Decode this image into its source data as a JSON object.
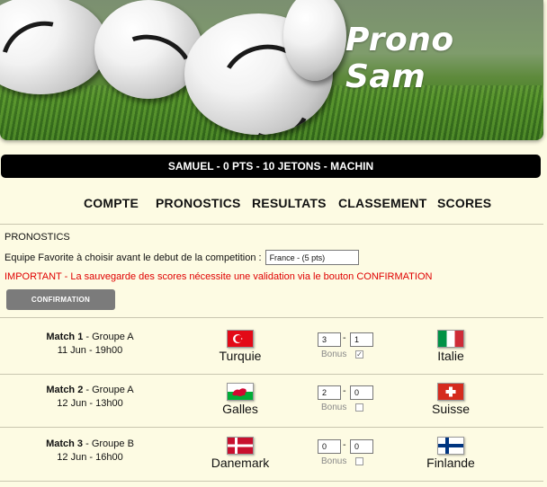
{
  "banner": {
    "brand": "Prono Sam"
  },
  "user_bar": {
    "text": "SAMUEL - 0 PTS - 10 JETONS - MACHIN"
  },
  "nav": {
    "items": [
      "COMPTE",
      "PRONOSTICS",
      "RESULTATS",
      "CLASSEMENT",
      "SCORES"
    ]
  },
  "section": {
    "title": "PRONOSTICS",
    "favorite_label": "Equipe Favorite à choisir avant le debut de la competition :",
    "favorite_value": "France - (5 pts)",
    "important": "IMPORTANT - La sauvegarde des scores nécessite une validation via le bouton CONFIRMATION",
    "confirm_label": "CONFIRMATION"
  },
  "matches": [
    {
      "match": "Match 1",
      "group": " - Groupe A",
      "date": "11 Jun - 19h00",
      "home": "Turquie",
      "away": "Italie",
      "home_score": "3",
      "away_score": "1",
      "bonus_label": "Bonus",
      "bonus_checked": true,
      "home_flag": "turkey-flag",
      "away_flag": "italy-flag"
    },
    {
      "match": "Match 2",
      "group": " - Groupe A",
      "date": "12 Jun - 13h00",
      "home": "Galles",
      "away": "Suisse",
      "home_score": "2",
      "away_score": "0",
      "bonus_label": "Bonus",
      "bonus_checked": false,
      "home_flag": "wales-flag",
      "away_flag": "switzerland-flag"
    },
    {
      "match": "Match 3",
      "group": " - Groupe B",
      "date": "12 Jun - 16h00",
      "home": "Danemark",
      "away": "Finlande",
      "home_score": "0",
      "away_score": "0",
      "bonus_label": "Bonus",
      "bonus_checked": false,
      "home_flag": "denmark-flag",
      "away_flag": "finland-flag"
    }
  ],
  "colors": {
    "background": "#fdfbe3",
    "bar": "#000000",
    "important": "#e00000",
    "button": "#7b7b7b"
  }
}
